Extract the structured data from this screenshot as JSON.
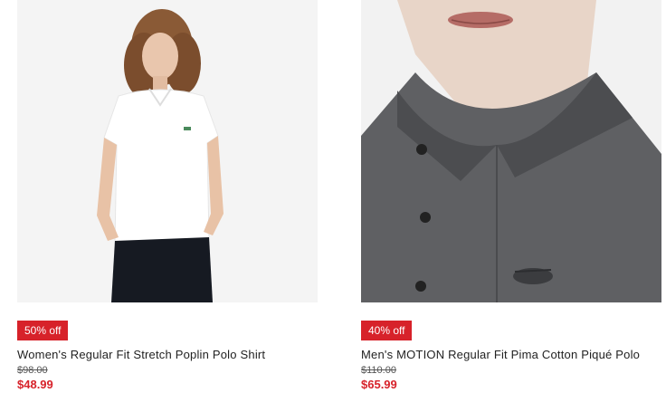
{
  "products": [
    {
      "badge": "50% off",
      "name": "Women's Regular Fit Stretch Poplin Polo Shirt",
      "original_price": "$98.00",
      "sale_price": "$48.99",
      "image": "white-polo-photo"
    },
    {
      "badge": "40% off",
      "name": "Men's MOTION Regular Fit Pima Cotton Piqué Polo",
      "original_price": "$110.00",
      "sale_price": "$65.99",
      "image": "grey-polo-photo"
    }
  ],
  "colors": {
    "badge": "#d7222a",
    "sale_price": "#d7222a"
  }
}
